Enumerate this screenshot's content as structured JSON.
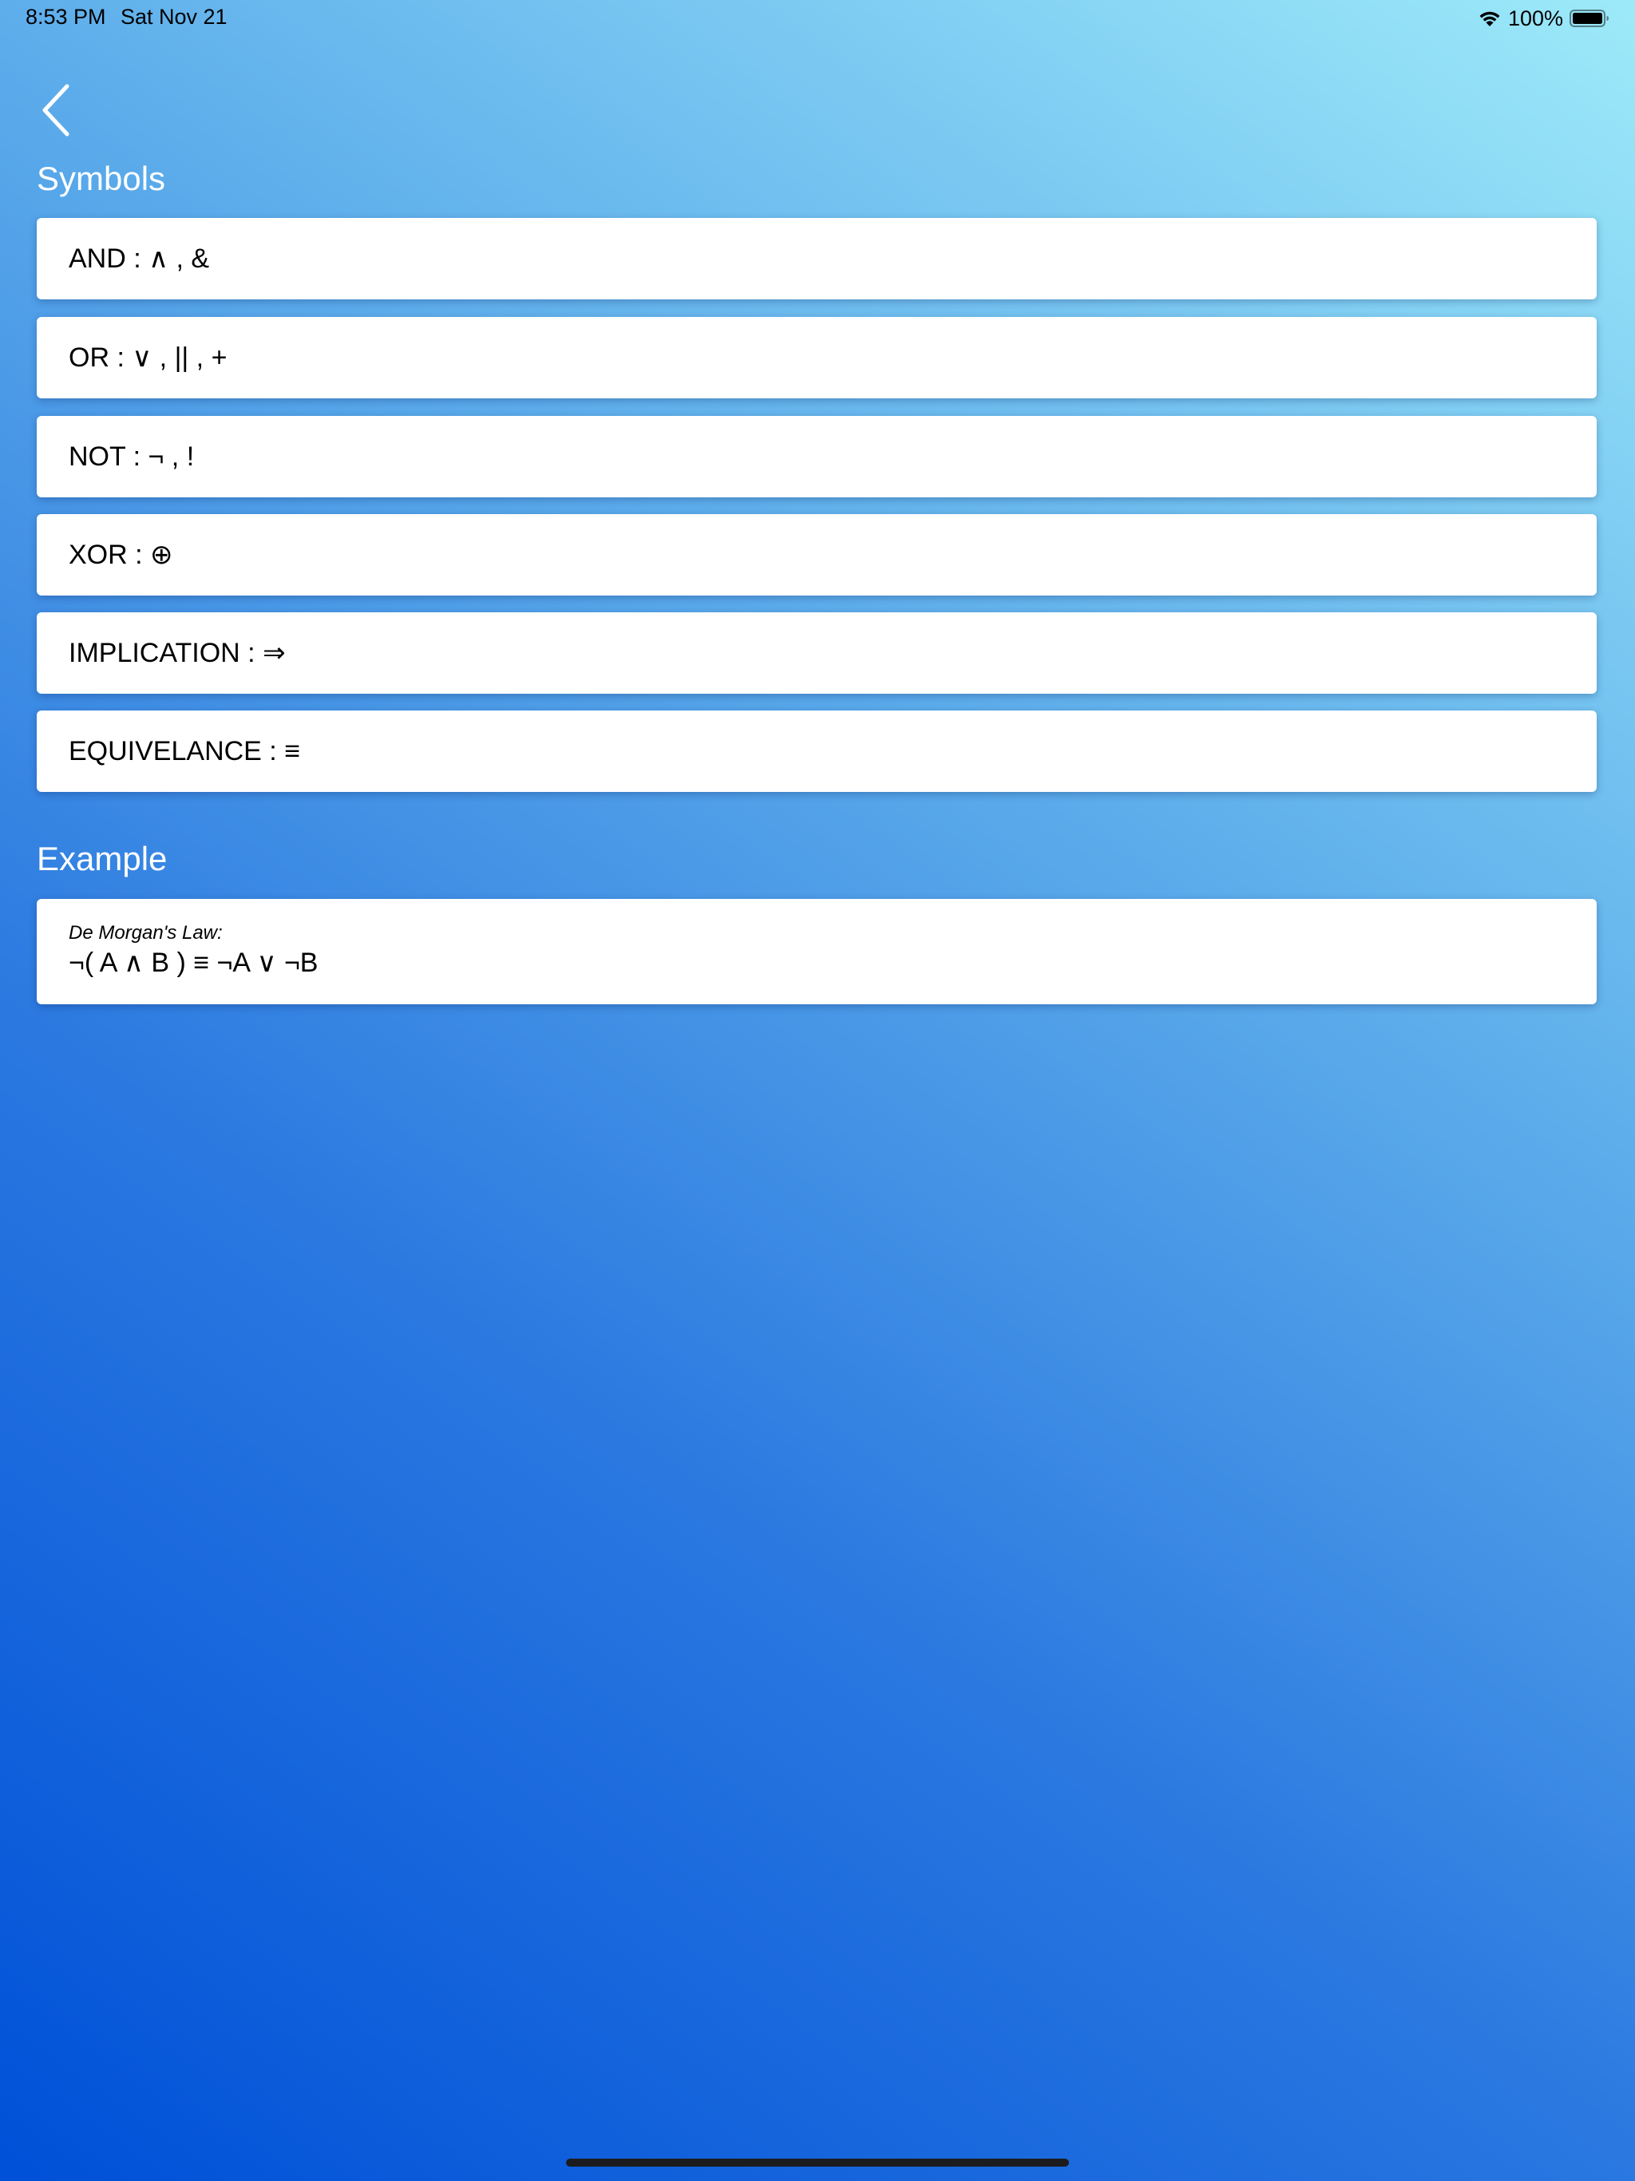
{
  "status_bar": {
    "time": "8:53 PM",
    "date": "Sat Nov 21",
    "battery_percent": "100%",
    "battery_level": 1.0,
    "icons": [
      "wifi-icon",
      "battery-icon"
    ]
  },
  "navigation": {
    "back_icon": "chevron-left-icon"
  },
  "symbols_section": {
    "title": "Symbols",
    "items": [
      {
        "label": "AND : ∧ , &"
      },
      {
        "label": "OR : ∨ , || , +"
      },
      {
        "label": "NOT : ¬ , !"
      },
      {
        "label": "XOR : ⊕"
      },
      {
        "label": "IMPLICATION : ⇒"
      },
      {
        "label": "EQUIVELANCE : ≡"
      }
    ]
  },
  "example_section": {
    "title": "Example",
    "caption": "De Morgan's Law:",
    "formula": "¬( A ∧ B ) ≡ ¬A ∨ ¬B"
  },
  "colors": {
    "gradient_start": "#0050d8",
    "gradient_end": "#9deaf9",
    "card_background": "#ffffff",
    "section_title": "#ffffff"
  }
}
